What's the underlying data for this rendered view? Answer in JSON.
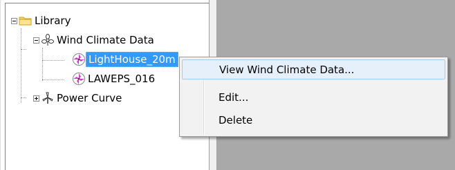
{
  "tree": {
    "root": {
      "label": "Library",
      "expanded": true
    },
    "folders": [
      {
        "label": "Wind Climate Data",
        "expanded": true,
        "children": [
          {
            "label": "LightHouse_20m",
            "selected": true
          },
          {
            "label": "LAWEPS_016"
          }
        ]
      },
      {
        "label": "Power Curve",
        "expanded": false
      }
    ]
  },
  "context_menu": {
    "items": [
      {
        "label": "View Wind Climate Data...",
        "highlighted": true
      },
      {
        "label": "Edit..."
      },
      {
        "label": "Delete"
      }
    ]
  },
  "colors": {
    "selection": "#3399ff",
    "menu_hover": "#e5f0fb",
    "right_pane": "#a9a9a9"
  }
}
